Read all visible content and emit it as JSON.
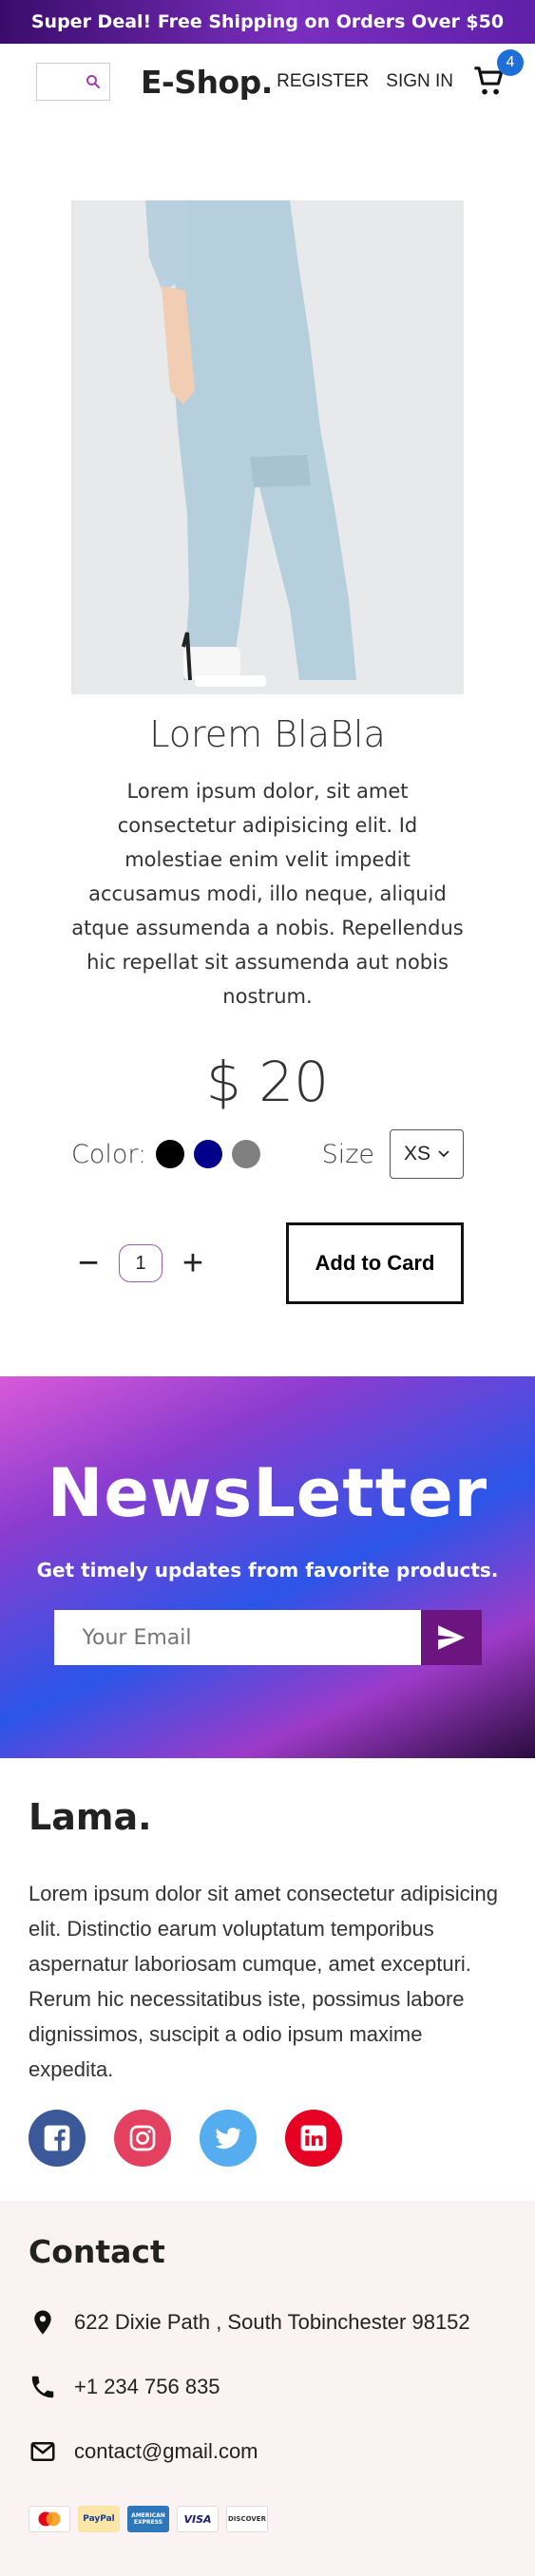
{
  "promo": {
    "text": "Super Deal! Free Shipping on Orders Over $50"
  },
  "header": {
    "brand": "E-Shop.",
    "register": "REGISTER",
    "signin": "SIGN IN",
    "cart_count": "4",
    "icons": {
      "search": "search-icon",
      "cart": "cart-icon"
    }
  },
  "product": {
    "title": "Lorem BlaBla",
    "description": "Lorem ipsum dolor, sit amet consectetur adipisicing elit. Id molestiae enim velit impedit accusamus modi, illo neque, aliquid atque assumenda a nobis. Repellendus hic repellat sit assumenda aut nobis nostrum.",
    "price": "$ 20",
    "color_label": "Color:",
    "colors": [
      "#000000",
      "#00008b",
      "#808080"
    ],
    "size_label": "Size",
    "size_selected": "XS",
    "quantity": "1",
    "decrease_symbol": "−",
    "increase_symbol": "+",
    "add_label": "Add to Card"
  },
  "newsletter": {
    "title": "NewsLetter",
    "subtitle": "Get timely updates from favorite products.",
    "placeholder": "Your Email",
    "send_icon": "send-icon"
  },
  "footer": {
    "brand": "Lama.",
    "description": "Lorem ipsum dolor sit amet consectetur adipisicing elit. Distinctio earum voluptatum temporibus aspernatur laboriosam cumque, amet excepturi. Rerum hic necessitatibus iste, possimus labore dignissimos, suscipit a odio ipsum maxime expedita.",
    "socials": [
      {
        "icon": "facebook-icon",
        "color": "#3b5999"
      },
      {
        "icon": "instagram-icon",
        "color": "#e4405f"
      },
      {
        "icon": "twitter-icon",
        "color": "#55acee"
      },
      {
        "icon": "linkedin-icon",
        "color": "#e60023"
      }
    ],
    "contact_title": "Contact",
    "address": "622 Dixie Path , South Tobinchester 98152",
    "phone": "+1 234 756 835",
    "email": "contact@gmail.com",
    "payment_cards": [
      "MasterCard",
      "PayPal",
      "AMERICAN EXPRESS",
      "VISA",
      "DISCOVER"
    ]
  }
}
